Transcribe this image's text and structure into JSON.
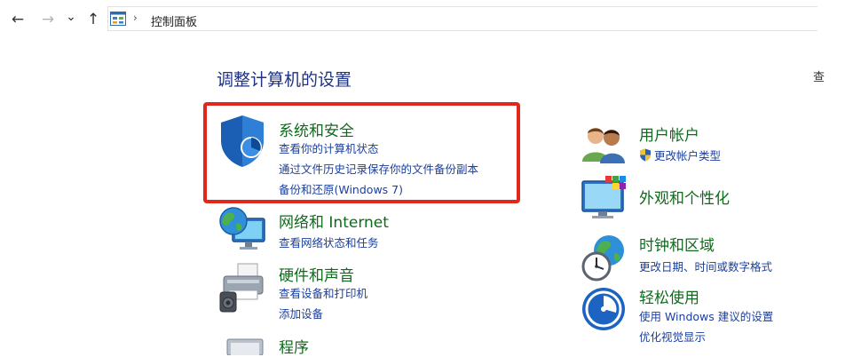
{
  "nav": {
    "back_icon": "arrow-left-icon",
    "forward_icon": "arrow-right-icon",
    "recent_icon": "chevron-down-icon",
    "up_icon": "arrow-up-icon",
    "back_glyph": "←",
    "forward_glyph": "→",
    "recent_glyph": "⌄",
    "up_glyph": "↑"
  },
  "address": {
    "separator": "›",
    "path": "控制面板"
  },
  "page": {
    "title": "调整计算机的设置",
    "view_by_cut": "查"
  },
  "categories": {
    "security": {
      "title": "系统和安全",
      "links": [
        "查看你的计算机状态",
        "通过文件历史记录保存你的文件备份副本",
        "备份和还原(Windows 7)"
      ]
    },
    "network": {
      "title": "网络和 Internet",
      "links": [
        "查看网络状态和任务"
      ]
    },
    "hardware": {
      "title": "硬件和声音",
      "links": [
        "查看设备和打印机",
        "添加设备"
      ]
    },
    "programs": {
      "title": "程序"
    },
    "users": {
      "title": "用户帐户",
      "links": [
        "更改帐户类型"
      ]
    },
    "appearance": {
      "title": "外观和个性化"
    },
    "clock": {
      "title": "时钟和区域",
      "links": [
        "更改日期、时间或数字格式"
      ]
    },
    "ease": {
      "title": "轻松使用",
      "links": [
        "使用 Windows 建议的设置",
        "优化视觉显示"
      ]
    }
  },
  "colors": {
    "title_blue": "#1e3287",
    "category_green": "#0f6b1c",
    "link_blue": "#1b3f9e",
    "highlight_red": "#e1261c"
  }
}
